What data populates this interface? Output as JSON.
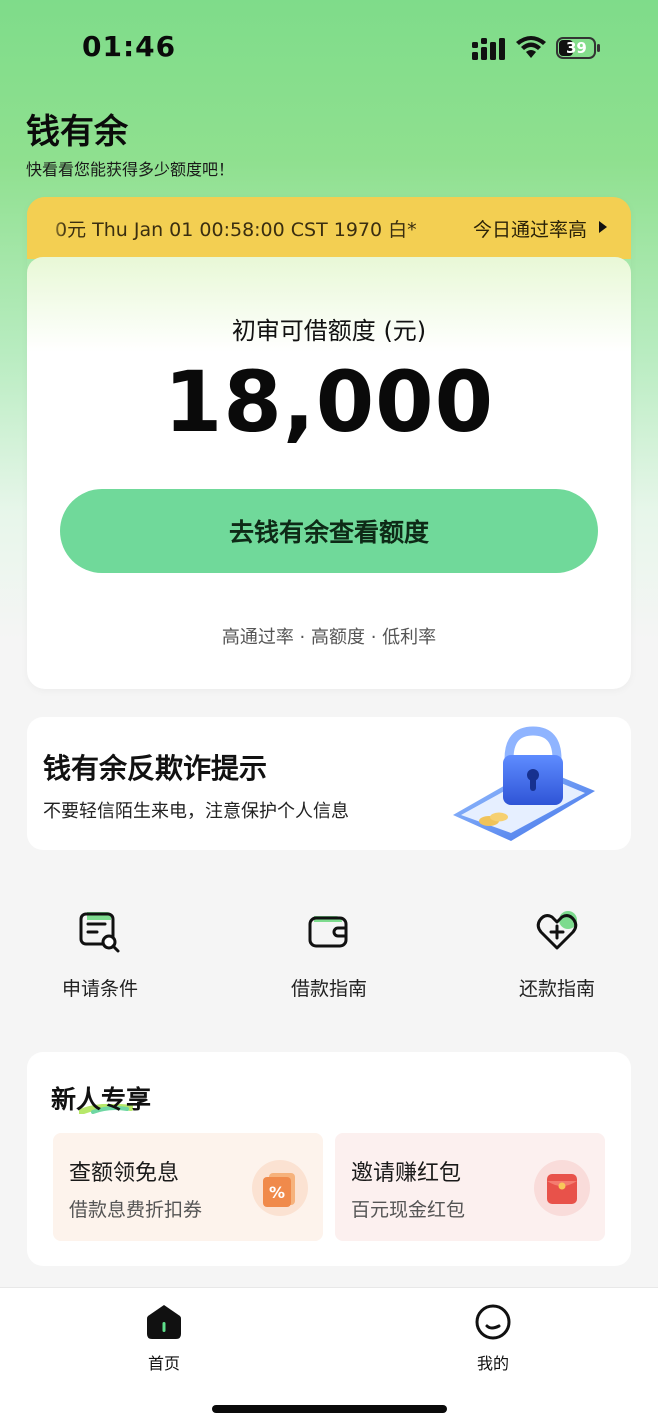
{
  "status_bar": {
    "time": "01:46",
    "battery": "39"
  },
  "header": {
    "title": "钱有余",
    "subtitle": "快看看您能获得多少额度吧！"
  },
  "ticker": {
    "text": "0元   Thu Jan 01 00:58:00 CST 1970   白*",
    "right_text": "今日通过率高"
  },
  "credit_card": {
    "label": "初审可借额度 (元)",
    "amount": "18,000",
    "cta_label": "去钱有余查看额度",
    "footer": "高通过率 · 高额度 · 低利率"
  },
  "fraud_banner": {
    "title": "钱有余反欺诈提示",
    "subtitle": "不要轻信陌生来电，注意保护个人信息"
  },
  "quick_links": [
    {
      "label": "申请条件",
      "icon": "document-search-icon"
    },
    {
      "label": "借款指南",
      "icon": "wallet-icon"
    },
    {
      "label": "还款指南",
      "icon": "heart-plus-icon"
    }
  ],
  "newbie": {
    "title": "新人专享",
    "promos": [
      {
        "title": "查额领免息",
        "subtitle": "借款息费折扣券",
        "icon": "coupon-icon"
      },
      {
        "title": "邀请赚红包",
        "subtitle": "百元现金红包",
        "icon": "red-envelope-icon"
      }
    ]
  },
  "tabbar": {
    "tabs": [
      {
        "label": "首页",
        "icon": "home-icon"
      },
      {
        "label": "我的",
        "icon": "profile-icon"
      }
    ]
  },
  "colors": {
    "brand_green": "#70d99a",
    "ticker_yellow": "#f3cf52"
  }
}
